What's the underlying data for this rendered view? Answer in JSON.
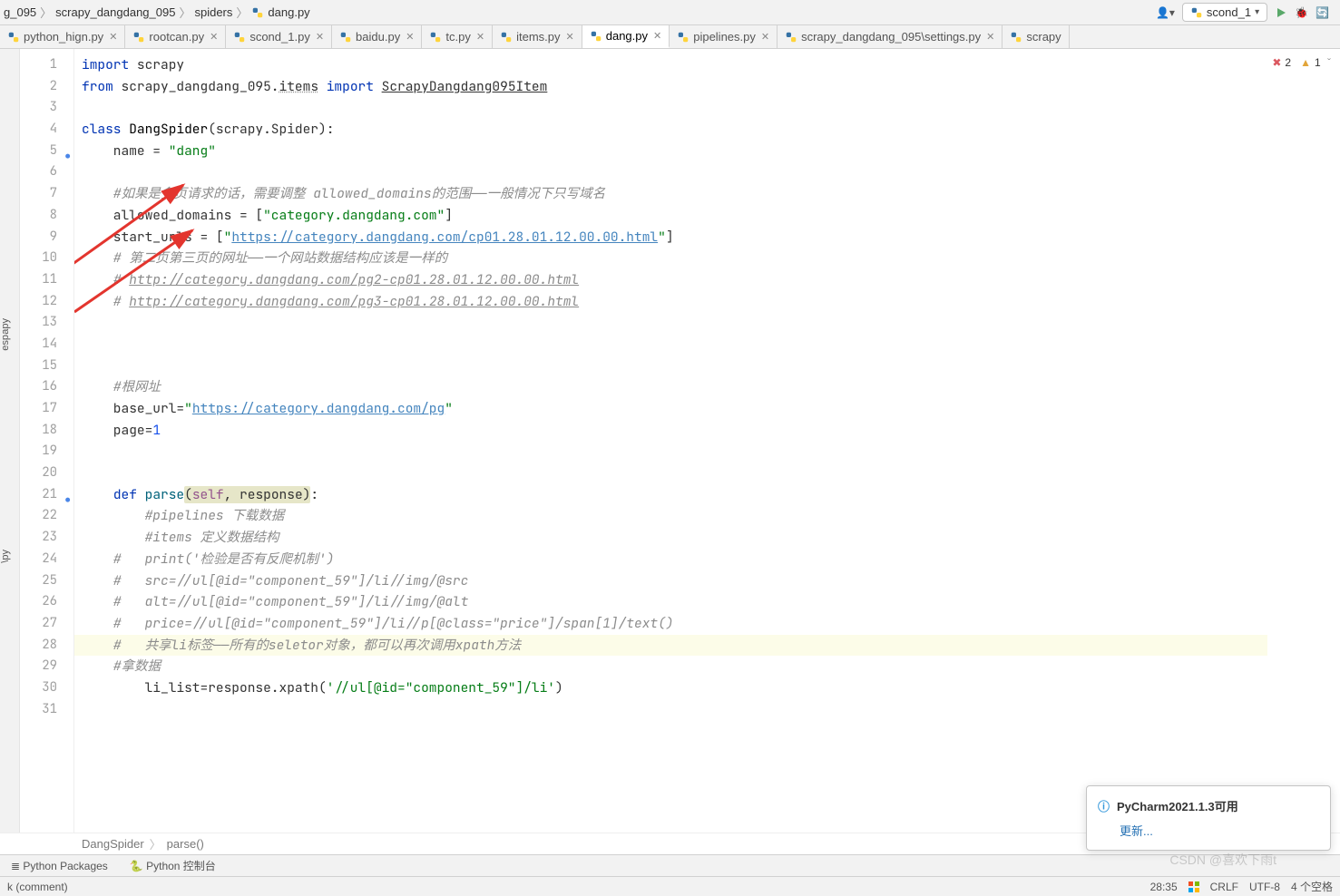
{
  "breadcrumb": {
    "items": [
      "g_095",
      "scrapy_dangdang_095",
      "spiders",
      "dang.py"
    ]
  },
  "runconfig": {
    "name": "scond_1"
  },
  "tabs": [
    {
      "label": "python_hign.py",
      "active": false
    },
    {
      "label": "rootcan.py",
      "active": false
    },
    {
      "label": "scond_1.py",
      "active": false
    },
    {
      "label": "baidu.py",
      "active": false
    },
    {
      "label": "tc.py",
      "active": false
    },
    {
      "label": "items.py",
      "active": false
    },
    {
      "label": "dang.py",
      "active": true
    },
    {
      "label": "pipelines.py",
      "active": false
    },
    {
      "label": "scrapy_dangdang_095\\settings.py",
      "active": false
    },
    {
      "label": "scrapy",
      "active": false
    }
  ],
  "errors": {
    "red": "2",
    "yellow": "1"
  },
  "code": {
    "l1": "import scrapy",
    "l2": "from scrapy_dangdang_095.items import ScrapyDangdang095Item",
    "l3": "",
    "l4": "class DangSpider(scrapy.Spider):",
    "l5": "    name = \"dang\"",
    "l6": "",
    "l7": "    #如果是多页请求的话，需要调整 allowed_domains的范围——一般情况下只写域名",
    "l8": "    allowed_domains = [\"category.dangdang.com\"]",
    "l9": "    start_urls = [\"https://category.dangdang.com/cp01.28.01.12.00.00.html\"]",
    "l10": "    # 第二页第三页的网址——一个网站数据结构应该是一样的",
    "l11": "    # http://category.dangdang.com/pg2-cp01.28.01.12.00.00.html",
    "l12": "    # http://category.dangdang.com/pg3-cp01.28.01.12.00.00.html",
    "l13": "",
    "l14": "",
    "l15": "",
    "l16": "    #根网址",
    "l17": "    base_url=\"https://category.dangdang.com/pg\"",
    "l18": "    page=1",
    "l19": "",
    "l20": "",
    "l21": "    def parse(self, response):",
    "l22": "        #pipelines 下载数据",
    "l23": "        #items 定义数据结构",
    "l24": "    #   print('检验是否有反爬机制')",
    "l25": "    #   src=//ul[@id=\"component_59\"]/li//img/@src",
    "l26": "    #   alt=//ul[@id=\"component_59\"]/li//img/@alt",
    "l27": "    #   price=//ul[@id=\"component_59\"]/li//p[@class=\"price\"]/span[1]/text()",
    "l28": "    #   共享li标签——所有的seletor对象，都可以再次调用xpath方法",
    "l29": "    #拿数据",
    "l30": "        li_list=response.xpath('//ul[@id=\"component_59\"]/li')"
  },
  "lines": [
    "1",
    "2",
    "3",
    "4",
    "5",
    "6",
    "7",
    "8",
    "9",
    "10",
    "11",
    "12",
    "13",
    "14",
    "15",
    "16",
    "17",
    "18",
    "19",
    "20",
    "21",
    "22",
    "23",
    "24",
    "25",
    "26",
    "27",
    "28",
    "29",
    "30",
    "31"
  ],
  "crumb": {
    "a": "DangSpider",
    "b": "parse()"
  },
  "tools": {
    "packages": "Python Packages",
    "console": "Python 控制台"
  },
  "status": {
    "left": "k (comment)",
    "pos": "28:35",
    "crlf": "CRLF",
    "enc": "UTF-8",
    "indent": "4 个空格"
  },
  "notif": {
    "title": "PyCharm2021.1.3可用",
    "action": "更新..."
  },
  "leftRail": {
    "a": "apy",
    "b": "esp",
    "c": "\\py"
  },
  "watermark": "CSDN @喜欢下雨t"
}
